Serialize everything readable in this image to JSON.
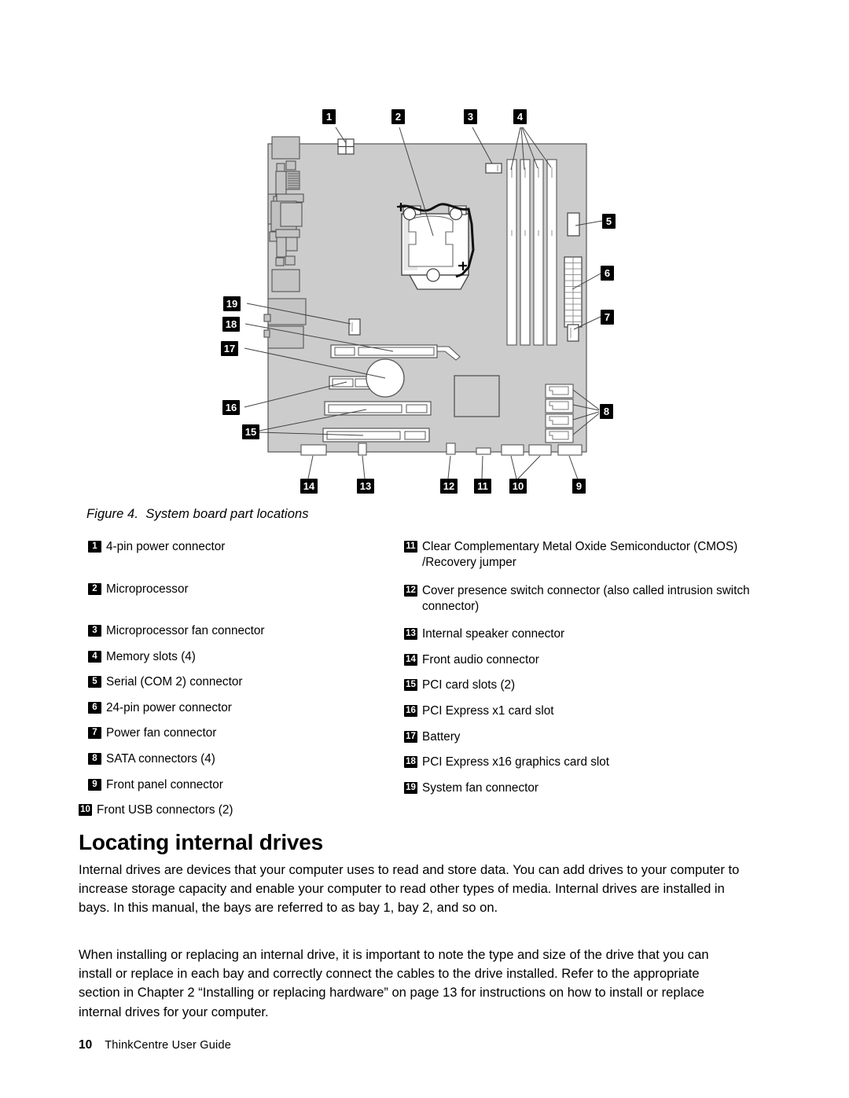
{
  "document": {
    "footer_page_number": "10",
    "footer_guide_title": "ThinkCentre User Guide"
  },
  "figure": {
    "caption": "Figure 4.  System board part locations",
    "board_color": "#cccccc",
    "outline_color": "#555555",
    "callouts": [
      {
        "id": "1",
        "label": "1"
      },
      {
        "id": "2",
        "label": "2"
      },
      {
        "id": "3",
        "label": "3"
      },
      {
        "id": "4",
        "label": "4"
      },
      {
        "id": "5",
        "label": "5"
      },
      {
        "id": "6",
        "label": "6"
      },
      {
        "id": "7",
        "label": "7"
      },
      {
        "id": "8",
        "label": "8"
      },
      {
        "id": "9",
        "label": "9"
      },
      {
        "id": "10",
        "label": "10"
      },
      {
        "id": "11",
        "label": "11"
      },
      {
        "id": "12",
        "label": "12"
      },
      {
        "id": "13",
        "label": "13"
      },
      {
        "id": "14",
        "label": "14"
      },
      {
        "id": "15",
        "label": "15"
      },
      {
        "id": "16",
        "label": "16"
      },
      {
        "id": "17",
        "label": "17"
      },
      {
        "id": "18",
        "label": "18"
      },
      {
        "id": "19",
        "label": "19"
      }
    ]
  },
  "legend": {
    "left": [
      {
        "num": "1",
        "text": "4-pin power connector"
      },
      {
        "num": "2",
        "text": "Microprocessor"
      },
      {
        "num": "3",
        "text": "Microprocessor fan connector"
      },
      {
        "num": "4",
        "text": "Memory slots (4)"
      },
      {
        "num": "5",
        "text": "Serial (COM 2) connector"
      },
      {
        "num": "6",
        "text": "24-pin power connector"
      },
      {
        "num": "7",
        "text": "Power fan connector"
      },
      {
        "num": "8",
        "text": "SATA connectors (4)"
      },
      {
        "num": "9",
        "text": "Front panel connector"
      },
      {
        "num": "10",
        "text": "Front USB connectors (2)"
      }
    ],
    "right": [
      {
        "num": "11",
        "text": "Clear Complementary Metal Oxide Semiconductor (CMOS) /Recovery jumper"
      },
      {
        "num": "12",
        "text": "Cover presence switch connector (also called intrusion switch connector)"
      },
      {
        "num": "13",
        "text": "Internal speaker connector"
      },
      {
        "num": "14",
        "text": "Front audio connector"
      },
      {
        "num": "15",
        "text": "PCI card slots (2)"
      },
      {
        "num": "16",
        "text": "PCI Express x1 card slot"
      },
      {
        "num": "17",
        "text": "Battery"
      },
      {
        "num": "18",
        "text": "PCI Express x16 graphics card slot"
      },
      {
        "num": "19",
        "text": "System fan connector"
      }
    ]
  },
  "section": {
    "heading": "Locating internal drives",
    "paragraph_1": "Internal drives are devices that your computer uses to read and store data. You can add drives to your computer to increase storage capacity and enable your computer to read other types of media. Internal drives are installed in bays. In this manual, the bays are referred to as bay 1, bay 2, and so on.",
    "paragraph_2": "When installing or replacing an internal drive, it is important to note the type and size of the drive that you can install or replace in each bay and correctly connect the cables to the drive installed. Refer to the appropriate section in Chapter 2 “Installing or replacing hardware” on page 13 for instructions on how to install or replace internal drives for your computer."
  }
}
